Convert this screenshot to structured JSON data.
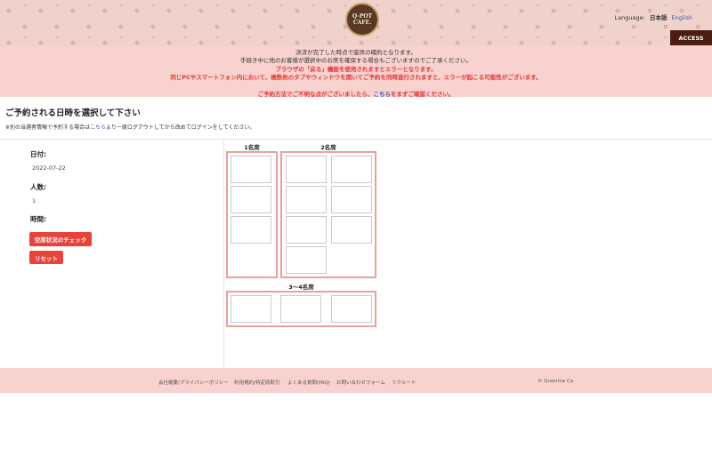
{
  "header": {
    "logo_line1": "Q-POT",
    "logo_line2": "CAFE.",
    "language_label": "Language:",
    "language_current": "日本語",
    "language_alt": "English",
    "access_label": "ACCESS"
  },
  "notice": {
    "line1": "決済が完了した時点で座席の確約となります。",
    "line2": "手続き中に他のお客様が選択中のお席を確保する場合もございますのでご了承ください。",
    "line3": "ブラウザの「戻る」機能を使用されますとエラーとなります。",
    "line4": "同じPCやスマートフォン内において、複数枚のタブやウィンドウを開いてご予約を同時進行されますと、エラーが起こる可能性がございます。",
    "line5_prefix": "ご予約方法でご不明な点がございましたら、",
    "line5_link": "こちら",
    "line5_suffix": "をまずご確認ください。"
  },
  "page": {
    "title": "ご予約される日時を選択して下さい",
    "note_prefix": "※別の当選者情報で予約する場合は",
    "note_link": "こちら",
    "note_suffix": "より一度ログアウトしてから改めてログインをしてください。"
  },
  "form": {
    "date_label": "日付:",
    "date_value": "2022-07-22",
    "people_label": "人数:",
    "people_value": "1",
    "time_label": "時間:",
    "check_button": "空席状況のチェック",
    "reset_button": "リセット"
  },
  "seats": {
    "group1_label": "1名席",
    "group2_label": "2名席",
    "group3_label": "3〜4名席"
  },
  "footer": {
    "links": [
      "会社概要/プライバシーポリシー",
      "利用規約/特定商取引",
      "よくある質問(FAQ)",
      "お問い合わせフォーム",
      "リクルート"
    ],
    "copyright": "© Gramme Co"
  },
  "colors": {
    "accent_red": "#e8423a",
    "notice_bg": "#f8d2cf",
    "seat_border": "#e7a1a0",
    "access_bg": "#4a1f12"
  }
}
